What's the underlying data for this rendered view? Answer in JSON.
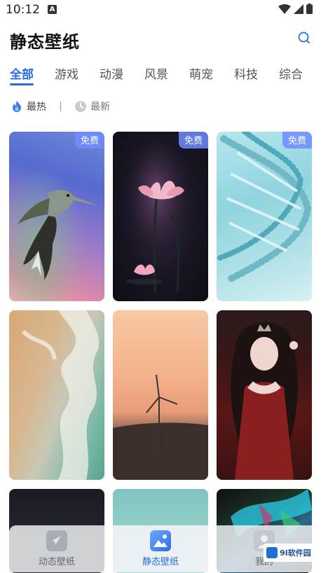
{
  "status": {
    "time": "10:12",
    "indicator": "A"
  },
  "app": {
    "title": "静态壁纸"
  },
  "tabs": [
    {
      "label": "全部",
      "active": true
    },
    {
      "label": "游戏"
    },
    {
      "label": "动漫"
    },
    {
      "label": "风景"
    },
    {
      "label": "萌宠"
    },
    {
      "label": "科技"
    },
    {
      "label": "综合"
    }
  ],
  "sort": {
    "hot_label": "最热",
    "new_label": "最新"
  },
  "wallpapers": [
    {
      "subject": "hummingbird",
      "badge": "免费"
    },
    {
      "subject": "lotus",
      "badge": "免费"
    },
    {
      "subject": "dna-helix",
      "badge": "免费"
    },
    {
      "subject": "smoke"
    },
    {
      "subject": "wind-turbine-sunset"
    },
    {
      "subject": "anime-girl-red-dress"
    },
    {
      "subject": "dark"
    },
    {
      "subject": "teal"
    },
    {
      "subject": "abstract-color"
    }
  ],
  "bottom_nav": [
    {
      "label": "动态壁纸",
      "icon": "rocket-icon"
    },
    {
      "label": "静态壁纸",
      "icon": "image-icon",
      "active": true
    },
    {
      "label": "我的",
      "icon": "user-icon"
    }
  ],
  "watermark": {
    "text": "9I软件园"
  },
  "colors": {
    "accent": "#2b6ce6"
  }
}
